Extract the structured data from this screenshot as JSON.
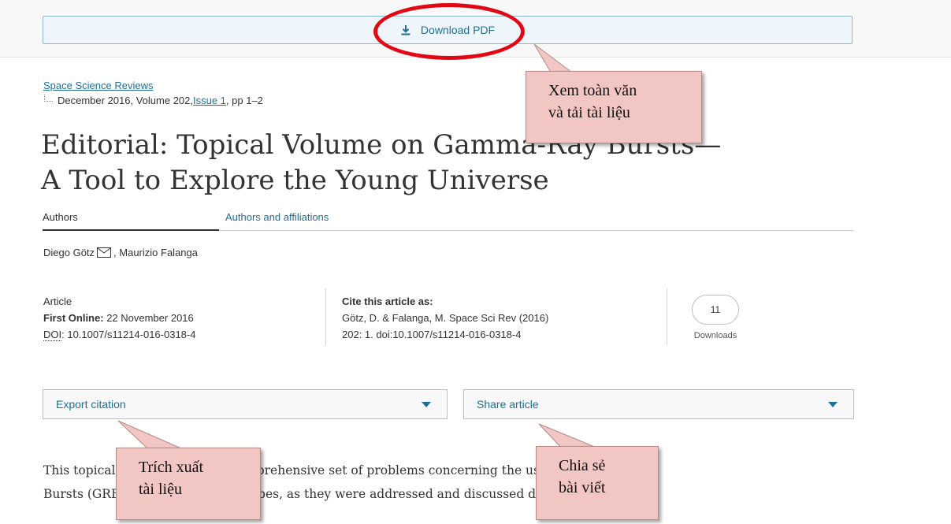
{
  "download": {
    "label": "Download PDF",
    "icon": "download-icon"
  },
  "article": {
    "journal": "Space Science Reviews",
    "issue_prefix": "December 2016, Volume 202, ",
    "issue_link": "Issue 1",
    "issue_suffix": ", pp 1–2",
    "title_line1": "Editorial: Topical Volume on Gamma-Ray Bursts—",
    "title_line2": "A Tool to Explore the Young Universe"
  },
  "tabs": {
    "authors": "Authors",
    "affiliations": "Authors and affiliations"
  },
  "authors": {
    "first": "Diego Götz",
    "rest": ", Maurizio Falanga"
  },
  "meta": {
    "type": "Article",
    "first_online_label": "First Online:",
    "first_online_value": "22 November 2016",
    "doi_label": "DOI",
    "doi_value": ": 10.1007/s11214-016-0318-4",
    "cite_heading": "Cite this article as:",
    "cite_line1": "Götz, D. & Falanga, M. Space Sci Rev (2016)",
    "cite_line2": "202: 1. doi:10.1007/s11214-016-0318-4",
    "downloads_count": "11",
    "downloads_label": "Downloads"
  },
  "actions": {
    "export": "Export citation",
    "share": "Share article"
  },
  "body": {
    "line1": "This topical volume reviews a comprehensive set of problems concerning the use of Gamma-Ray",
    "line2": "Bursts (GRBs) as cosmological probes, as they were addressed and discussed during the ISSI-"
  },
  "callouts": {
    "view_download": {
      "line1": "Xem toàn văn",
      "line2": "và tải tài liệu"
    },
    "export": {
      "line1": "Trích xuất",
      "line2": "tài liệu"
    },
    "share": {
      "line1": "Chia sẻ",
      "line2": "bài viết"
    }
  },
  "colors": {
    "link": "#1f6f96",
    "highlight": "#e30613",
    "callout_fill": "#f2c6c3"
  }
}
